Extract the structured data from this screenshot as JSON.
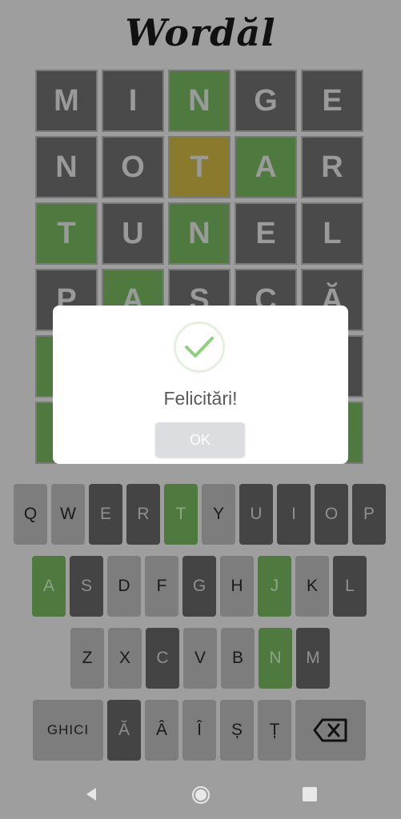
{
  "app": {
    "title": "Wordăl"
  },
  "board": {
    "rows": [
      [
        {
          "l": "M",
          "s": "absent"
        },
        {
          "l": "I",
          "s": "absent"
        },
        {
          "l": "N",
          "s": "correct"
        },
        {
          "l": "G",
          "s": "absent"
        },
        {
          "l": "E",
          "s": "absent"
        }
      ],
      [
        {
          "l": "N",
          "s": "absent"
        },
        {
          "l": "O",
          "s": "absent"
        },
        {
          "l": "T",
          "s": "present"
        },
        {
          "l": "A",
          "s": "correct"
        },
        {
          "l": "R",
          "s": "absent"
        }
      ],
      [
        {
          "l": "T",
          "s": "correct"
        },
        {
          "l": "U",
          "s": "absent"
        },
        {
          "l": "N",
          "s": "correct"
        },
        {
          "l": "E",
          "s": "absent"
        },
        {
          "l": "L",
          "s": "absent"
        }
      ],
      [
        {
          "l": "P",
          "s": "absent"
        },
        {
          "l": "A",
          "s": "correct"
        },
        {
          "l": "S",
          "s": "absent"
        },
        {
          "l": "C",
          "s": "absent"
        },
        {
          "l": "Ă",
          "s": "absent"
        }
      ],
      [
        {
          "l": "",
          "s": "correct"
        },
        {
          "l": "",
          "s": "absent"
        },
        {
          "l": "",
          "s": "absent"
        },
        {
          "l": "",
          "s": "absent"
        },
        {
          "l": "",
          "s": "absent"
        }
      ],
      [
        {
          "l": "",
          "s": "correct"
        },
        {
          "l": "",
          "s": "absent"
        },
        {
          "l": "",
          "s": "absent"
        },
        {
          "l": "",
          "s": "absent"
        },
        {
          "l": "",
          "s": "correct"
        }
      ]
    ]
  },
  "keyboard": {
    "rows": [
      [
        {
          "k": "Q",
          "s": "unused"
        },
        {
          "k": "W",
          "s": "unused"
        },
        {
          "k": "E",
          "s": "absent"
        },
        {
          "k": "R",
          "s": "absent"
        },
        {
          "k": "T",
          "s": "correct"
        },
        {
          "k": "Y",
          "s": "unused"
        },
        {
          "k": "U",
          "s": "absent"
        },
        {
          "k": "I",
          "s": "absent"
        },
        {
          "k": "O",
          "s": "absent"
        },
        {
          "k": "P",
          "s": "absent"
        }
      ],
      [
        {
          "k": "A",
          "s": "correct"
        },
        {
          "k": "S",
          "s": "absent"
        },
        {
          "k": "D",
          "s": "unused"
        },
        {
          "k": "F",
          "s": "unused"
        },
        {
          "k": "G",
          "s": "absent"
        },
        {
          "k": "H",
          "s": "unused"
        },
        {
          "k": "J",
          "s": "correct"
        },
        {
          "k": "K",
          "s": "unused"
        },
        {
          "k": "L",
          "s": "absent"
        }
      ],
      [
        {
          "k": "Z",
          "s": "unused"
        },
        {
          "k": "X",
          "s": "unused"
        },
        {
          "k": "C",
          "s": "absent"
        },
        {
          "k": "V",
          "s": "unused"
        },
        {
          "k": "B",
          "s": "unused"
        },
        {
          "k": "N",
          "s": "correct"
        },
        {
          "k": "M",
          "s": "absent"
        }
      ],
      [
        {
          "k": "GHICI",
          "s": "unused",
          "t": "enter"
        },
        {
          "k": "Ă",
          "s": "absent"
        },
        {
          "k": "Â",
          "s": "unused"
        },
        {
          "k": "Î",
          "s": "unused"
        },
        {
          "k": "Ș",
          "s": "unused"
        },
        {
          "k": "Ț",
          "s": "unused"
        },
        {
          "k": "",
          "s": "unused",
          "t": "backspace"
        }
      ]
    ]
  },
  "modal": {
    "message": "Felicitări!",
    "ok_label": "OK"
  },
  "colors": {
    "correct": "#4e7a40",
    "present": "#8a7a2e",
    "absent": "#4a4a4a",
    "check": "#8cd27a"
  }
}
